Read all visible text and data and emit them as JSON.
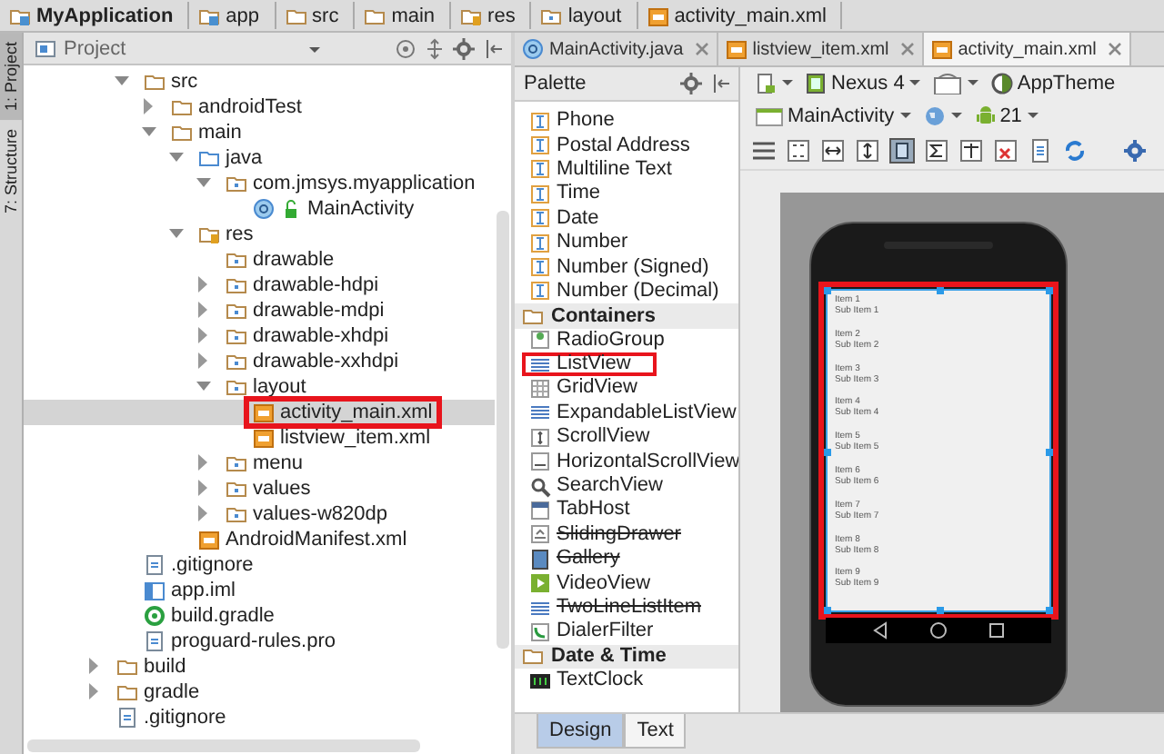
{
  "breadcrumbs": [
    {
      "label": "MyApplication",
      "kind": "project"
    },
    {
      "label": "app",
      "kind": "module"
    },
    {
      "label": "src",
      "kind": "folder"
    },
    {
      "label": "main",
      "kind": "folder"
    },
    {
      "label": "res",
      "kind": "res"
    },
    {
      "label": "layout",
      "kind": "package"
    },
    {
      "label": "activity_main.xml",
      "kind": "xml"
    }
  ],
  "tool_strip": [
    {
      "label": "1: Project",
      "selected": true
    },
    {
      "label": "7: Structure",
      "selected": false
    }
  ],
  "project_panel": {
    "title": "Project",
    "tree": [
      {
        "label": "src",
        "kind": "folder",
        "expanded": true,
        "selected": false,
        "marked": false,
        "children": [
          {
            "label": "androidTest",
            "kind": "folder",
            "expanded": false,
            "selected": false,
            "marked": false
          },
          {
            "label": "main",
            "kind": "folder",
            "expanded": true,
            "selected": false,
            "marked": false,
            "children": [
              {
                "label": "java",
                "kind": "source",
                "expanded": true,
                "selected": false,
                "marked": false,
                "children": [
                  {
                    "label": "com.jmsys.myapplication",
                    "kind": "package",
                    "expanded": true,
                    "selected": false,
                    "marked": false,
                    "children": [
                      {
                        "label": "MainActivity",
                        "kind": "class",
                        "selected": false,
                        "marked": false
                      }
                    ]
                  }
                ]
              },
              {
                "label": "res",
                "kind": "res",
                "expanded": true,
                "selected": false,
                "marked": false,
                "children": [
                  {
                    "label": "drawable",
                    "kind": "package",
                    "selected": false,
                    "marked": false
                  },
                  {
                    "label": "drawable-hdpi",
                    "kind": "package",
                    "expanded": false,
                    "selected": false,
                    "marked": false
                  },
                  {
                    "label": "drawable-mdpi",
                    "kind": "package",
                    "expanded": false,
                    "selected": false,
                    "marked": false
                  },
                  {
                    "label": "drawable-xhdpi",
                    "kind": "package",
                    "expanded": false,
                    "selected": false,
                    "marked": false
                  },
                  {
                    "label": "drawable-xxhdpi",
                    "kind": "package",
                    "expanded": false,
                    "selected": false,
                    "marked": false
                  },
                  {
                    "label": "layout",
                    "kind": "package",
                    "expanded": true,
                    "selected": false,
                    "marked": false,
                    "children": [
                      {
                        "label": "activity_main.xml",
                        "kind": "xml",
                        "selected": true,
                        "marked": true
                      },
                      {
                        "label": "listview_item.xml",
                        "kind": "xml",
                        "selected": false,
                        "marked": false
                      }
                    ]
                  },
                  {
                    "label": "menu",
                    "kind": "package",
                    "expanded": false,
                    "selected": false,
                    "marked": false
                  },
                  {
                    "label": "values",
                    "kind": "package",
                    "expanded": false,
                    "selected": false,
                    "marked": false
                  },
                  {
                    "label": "values-w820dp",
                    "kind": "package",
                    "expanded": false,
                    "selected": false,
                    "marked": false
                  }
                ]
              },
              {
                "label": "AndroidManifest.xml",
                "kind": "xml",
                "selected": false,
                "marked": false
              }
            ]
          }
        ]
      },
      {
        "label": ".gitignore",
        "kind": "text",
        "selected": false,
        "marked": false
      },
      {
        "label": "app.iml",
        "kind": "iml",
        "selected": false,
        "marked": false
      },
      {
        "label": "build.gradle",
        "kind": "gradle",
        "selected": false,
        "marked": false
      },
      {
        "label": "proguard-rules.pro",
        "kind": "text",
        "selected": false,
        "marked": false
      }
    ],
    "parent_level_items": [
      {
        "label": "build",
        "kind": "folder",
        "expanded": false,
        "selected": false,
        "marked": false
      },
      {
        "label": "gradle",
        "kind": "folder",
        "expanded": false,
        "selected": false,
        "marked": false
      },
      {
        "label": ".gitignore",
        "kind": "text",
        "selected": false,
        "marked": false
      }
    ]
  },
  "editor_tabs": [
    {
      "label": "MainActivity.java",
      "kind": "class",
      "selected": false
    },
    {
      "label": "listview_item.xml",
      "kind": "xml",
      "selected": false
    },
    {
      "label": "activity_main.xml",
      "kind": "xml",
      "selected": true
    }
  ],
  "palette": {
    "title": "Palette",
    "items": [
      {
        "label": "Phone",
        "kind": "text",
        "deprecated": false,
        "marked": false
      },
      {
        "label": "Postal Address",
        "kind": "text",
        "deprecated": false,
        "marked": false
      },
      {
        "label": "Multiline Text",
        "kind": "text",
        "deprecated": false,
        "marked": false
      },
      {
        "label": "Time",
        "kind": "text",
        "deprecated": false,
        "marked": false
      },
      {
        "label": "Date",
        "kind": "text",
        "deprecated": false,
        "marked": false
      },
      {
        "label": "Number",
        "kind": "text",
        "deprecated": false,
        "marked": false
      },
      {
        "label": "Number (Signed)",
        "kind": "text",
        "deprecated": false,
        "marked": false
      },
      {
        "label": "Number (Decimal)",
        "kind": "text",
        "deprecated": false,
        "marked": false
      },
      {
        "label": "Containers",
        "kind": "section"
      },
      {
        "label": "RadioGroup",
        "kind": "radio",
        "deprecated": false,
        "marked": false
      },
      {
        "label": "ListView",
        "kind": "list",
        "deprecated": false,
        "marked": true
      },
      {
        "label": "GridView",
        "kind": "grid",
        "deprecated": false,
        "marked": false
      },
      {
        "label": "ExpandableListView",
        "kind": "list",
        "deprecated": false,
        "marked": false
      },
      {
        "label": "ScrollView",
        "kind": "scroll",
        "deprecated": false,
        "marked": false
      },
      {
        "label": "HorizontalScrollView",
        "kind": "hscroll",
        "deprecated": false,
        "marked": false
      },
      {
        "label": "SearchView",
        "kind": "search",
        "deprecated": false,
        "marked": false
      },
      {
        "label": "TabHost",
        "kind": "tab",
        "deprecated": false,
        "marked": false
      },
      {
        "label": "SlidingDrawer",
        "kind": "drawer",
        "deprecated": true,
        "marked": false
      },
      {
        "label": "Gallery",
        "kind": "image",
        "deprecated": true,
        "marked": false
      },
      {
        "label": "VideoView",
        "kind": "video",
        "deprecated": false,
        "marked": false
      },
      {
        "label": "TwoLineListItem",
        "kind": "list",
        "deprecated": true,
        "marked": false
      },
      {
        "label": "DialerFilter",
        "kind": "phone",
        "deprecated": false,
        "marked": false
      },
      {
        "label": "Date & Time",
        "kind": "section"
      },
      {
        "label": "TextClock",
        "kind": "clock",
        "deprecated": false,
        "marked": false
      }
    ]
  },
  "designer": {
    "device": "Nexus 4",
    "theme": "AppTheme",
    "activity": "MainActivity",
    "api_level": "21",
    "list_items": [
      {
        "title": "Item 1",
        "subtitle": "Sub Item 1"
      },
      {
        "title": "Item 2",
        "subtitle": "Sub Item 2"
      },
      {
        "title": "Item 3",
        "subtitle": "Sub Item 3"
      },
      {
        "title": "Item 4",
        "subtitle": "Sub Item 4"
      },
      {
        "title": "Item 5",
        "subtitle": "Sub Item 5"
      },
      {
        "title": "Item 6",
        "subtitle": "Sub Item 6"
      },
      {
        "title": "Item 7",
        "subtitle": "Sub Item 7"
      },
      {
        "title": "Item 8",
        "subtitle": "Sub Item 8"
      },
      {
        "title": "Item 9",
        "subtitle": "Sub Item 9"
      }
    ],
    "screen_marked": true
  },
  "bottom_tabs": [
    {
      "label": "Design",
      "selected": true
    },
    {
      "label": "Text",
      "selected": false
    }
  ]
}
